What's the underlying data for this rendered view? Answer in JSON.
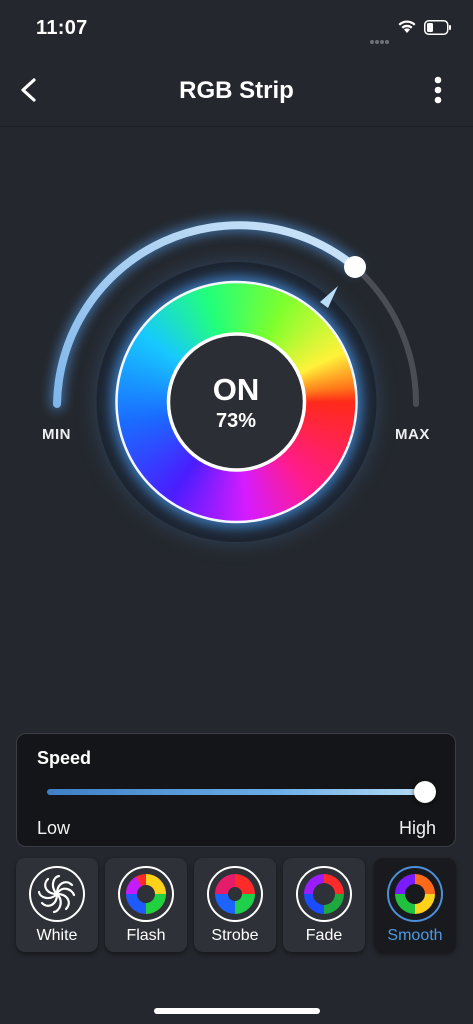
{
  "status_bar": {
    "time": "11:07"
  },
  "header": {
    "title": "RGB Strip"
  },
  "dial": {
    "state": "ON",
    "brightness_text": "73%",
    "brightness_fraction": 0.73,
    "min_label": "MIN",
    "max_label": "MAX"
  },
  "speed": {
    "title": "Speed",
    "low_label": "Low",
    "high_label": "High",
    "level_fraction": 1.0
  },
  "modes": [
    {
      "label": "White",
      "icon": "white-swirl-icon"
    },
    {
      "label": "Flash",
      "icon": "flash-swirl-icon"
    },
    {
      "label": "Strobe",
      "icon": "strobe-swirl-icon"
    },
    {
      "label": "Fade",
      "icon": "fade-swirl-icon"
    },
    {
      "label": "Smooth",
      "icon": "smooth-swirl-icon"
    }
  ],
  "selected_mode": "Smooth",
  "colors": {
    "background": "#24272d",
    "accent": "#4d9ae6",
    "card": "#141518"
  }
}
